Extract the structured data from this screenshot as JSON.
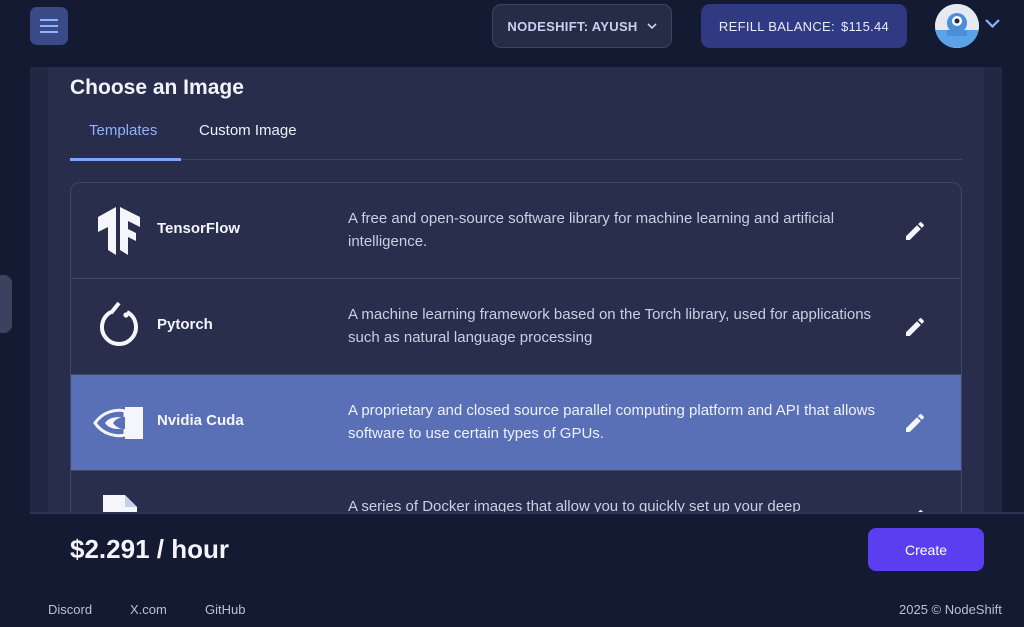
{
  "header": {
    "menu_icon": "hamburger-menu-icon",
    "org_label": "NODESHIFT: AYUSH",
    "refill_label": "REFILL BALANCE:",
    "refill_amount": "$115.44",
    "accent_color": "#2f3a82"
  },
  "image_section": {
    "title": "Choose an Image",
    "tabs": [
      {
        "label": "Templates",
        "active": true
      },
      {
        "label": "Custom Image",
        "active": false
      }
    ],
    "templates": [
      {
        "name": "TensorFlow",
        "icon": "tensorflow-logo-icon",
        "description": "A free and open-source software library for machine learning and artificial intelligence.",
        "selected": false
      },
      {
        "name": "Pytorch",
        "icon": "pytorch-logo-icon",
        "description": "A machine learning framework based on the Torch library, used for applications such as natural language processing",
        "selected": false
      },
      {
        "name": "Nvidia Cuda",
        "icon": "nvidia-logo-icon",
        "description": "A proprietary and closed source parallel computing platform and API that allows software to use certain types of GPUs.",
        "selected": true
      },
      {
        "name": "",
        "icon": "document-icon",
        "description": "A series of Docker images that allow you to quickly set up your deep",
        "selected": false
      }
    ],
    "selected_color": "#5a70b6"
  },
  "footer": {
    "price": "$2.291 / hour",
    "create_label": "Create",
    "create_color": "#5a3ef0",
    "links": [
      "Discord",
      "X.com",
      "GitHub"
    ],
    "copyright": "2025 © NodeShift"
  }
}
